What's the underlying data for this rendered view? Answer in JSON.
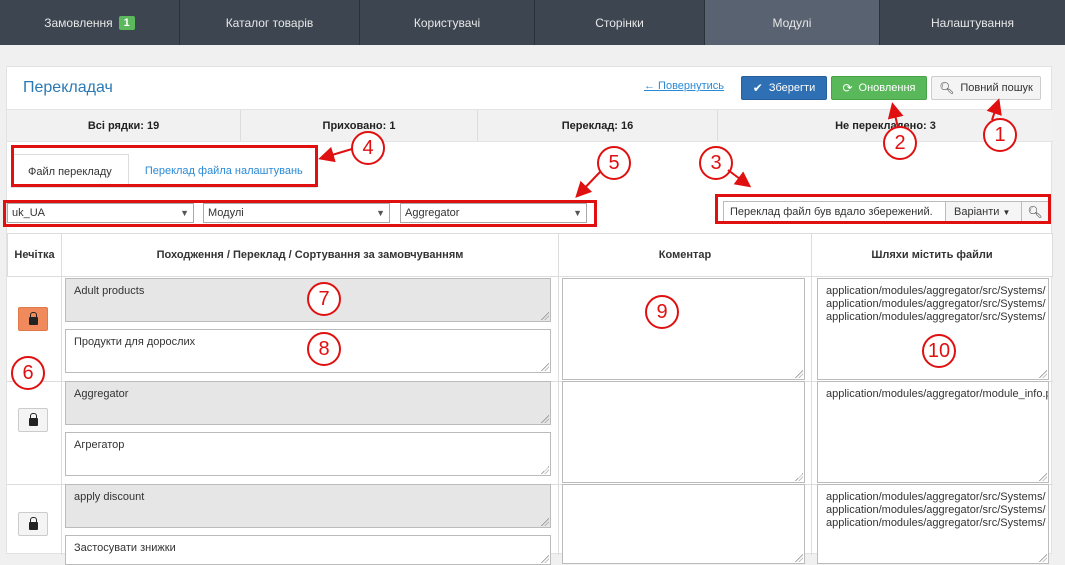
{
  "topnav": {
    "tabs": [
      {
        "label": "Замовлення",
        "badge": "1"
      },
      {
        "label": "Каталог товарів"
      },
      {
        "label": "Користувачі"
      },
      {
        "label": "Сторінки"
      },
      {
        "label": "Модулі"
      },
      {
        "label": "Налаштування"
      }
    ]
  },
  "header": {
    "title": "Перекладач",
    "back_label": "← Повернутись",
    "save_label": "Зберегти",
    "update_label": "Оновлення",
    "full_search_label": "Повний пошук"
  },
  "stats": {
    "all_rows": "Всі рядки: 19",
    "hidden": "Приховано: 1",
    "translated": "Переклад: 16",
    "not_translated": "Не перекладено: 3"
  },
  "tabs": {
    "file_translation": "Файл перекладу",
    "settings_file_translation": "Переклад файла налаштувань"
  },
  "filters": {
    "language": "uk_UA",
    "section": "Модулі",
    "module": "Aggregator"
  },
  "search": {
    "value": "Переклад файл був вдало збережений.",
    "variants_label": "Варіанти"
  },
  "table": {
    "col_odd": "Нечітка",
    "col_origin": "Походження / Переклад / Сортування за замовчуванням",
    "col_comment": "Коментар",
    "col_paths": "Шляхи містить файли",
    "rows": [
      {
        "origin": "Adult products",
        "translation": "Продукти для дорослих",
        "paths": "application/modules/aggregator/src/Systems/\napplication/modules/aggregator/src/Systems/\napplication/modules/aggregator/src/Systems/"
      },
      {
        "origin": "Aggregator",
        "translation": "Агрегатор",
        "paths": "application/modules/aggregator/module_info.p"
      },
      {
        "origin": "apply discount",
        "translation": "Застосувати знижки",
        "paths": "application/modules/aggregator/src/Systems/\napplication/modules/aggregator/src/Systems/\napplication/modules/aggregator/src/Systems/"
      }
    ]
  },
  "annotations": [
    "1",
    "2",
    "3",
    "4",
    "5",
    "6",
    "7",
    "8",
    "9",
    "10"
  ],
  "colors": {
    "nav_bg": "#3c4550",
    "nav_active": "#596270",
    "primary": "#2f6fb3",
    "success": "#58b85a",
    "annotation": "#e01010",
    "lock_active": "#f08a5d"
  }
}
